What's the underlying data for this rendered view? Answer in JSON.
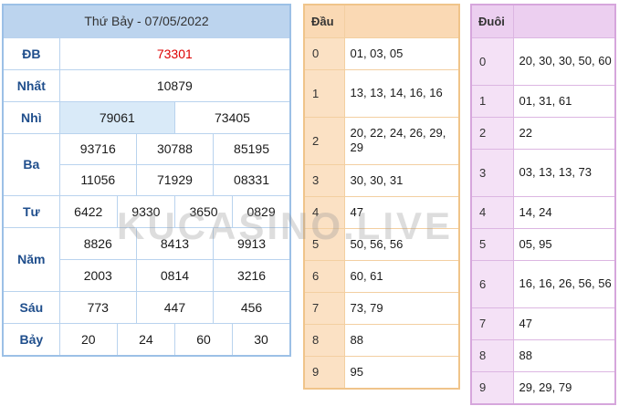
{
  "results": {
    "title": "Thứ Bảy - 07/05/2022",
    "prizes": {
      "db": {
        "label": "ĐB",
        "values": [
          "73301"
        ]
      },
      "nhat": {
        "label": "Nhất",
        "values": [
          "10879"
        ]
      },
      "nhi": {
        "label": "Nhì",
        "values": [
          "79061",
          "73405"
        ]
      },
      "ba": {
        "label": "Ba",
        "values": [
          "93716",
          "30788",
          "85195",
          "11056",
          "71929",
          "08331"
        ]
      },
      "tu": {
        "label": "Tư",
        "values": [
          "6422",
          "9330",
          "3650",
          "0829"
        ]
      },
      "nam": {
        "label": "Năm",
        "values": [
          "8826",
          "8413",
          "9913",
          "2003",
          "0814",
          "3216"
        ]
      },
      "sau": {
        "label": "Sáu",
        "values": [
          "773",
          "447",
          "456"
        ]
      },
      "bay": {
        "label": "Bảy",
        "values": [
          "20",
          "24",
          "60",
          "30"
        ]
      }
    }
  },
  "dau": {
    "header": "Đầu",
    "rows": [
      {
        "k": "0",
        "v": "01, 03, 05"
      },
      {
        "k": "1",
        "v": "13, 13, 14, 16, 16"
      },
      {
        "k": "2",
        "v": "20, 22, 24, 26, 29, 29"
      },
      {
        "k": "3",
        "v": "30, 30, 31"
      },
      {
        "k": "4",
        "v": "47"
      },
      {
        "k": "5",
        "v": "50, 56, 56"
      },
      {
        "k": "6",
        "v": "60, 61"
      },
      {
        "k": "7",
        "v": "73, 79"
      },
      {
        "k": "8",
        "v": "88"
      },
      {
        "k": "9",
        "v": "95"
      }
    ]
  },
  "duoi": {
    "header": "Đuôi",
    "rows": [
      {
        "k": "0",
        "v": "20, 30, 30, 50, 60"
      },
      {
        "k": "1",
        "v": "01, 31, 61"
      },
      {
        "k": "2",
        "v": "22"
      },
      {
        "k": "3",
        "v": "03, 13, 13, 73"
      },
      {
        "k": "4",
        "v": "14, 24"
      },
      {
        "k": "5",
        "v": "05, 95"
      },
      {
        "k": "6",
        "v": "16, 16, 26, 56, 56"
      },
      {
        "k": "7",
        "v": "47"
      },
      {
        "k": "8",
        "v": "88"
      },
      {
        "k": "9",
        "v": "29, 29, 79"
      }
    ]
  },
  "watermark": "KUCASINO.LIVE",
  "colors": {
    "special_prize": "#dd0000",
    "label": "#1f4e8c",
    "dau_header": "#fad9b4",
    "duoi_header": "#eccff0"
  }
}
